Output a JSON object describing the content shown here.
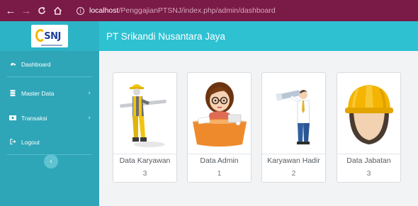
{
  "browser": {
    "url_host": "localhost",
    "url_path": "/PenggajianPTSNJ/index.php/admin/dashboard",
    "icons": [
      "back-arrow-icon",
      "forward-arrow-icon",
      "reload-icon",
      "home-icon",
      "info-icon"
    ]
  },
  "sidebar": {
    "logo_text": "SNJ",
    "items": [
      {
        "label": "Dashboard",
        "icon": "dashboard-icon"
      },
      {
        "label": "Master Data",
        "icon": "database-icon"
      },
      {
        "label": "Transaksi",
        "icon": "money-icon"
      },
      {
        "label": "Logout",
        "icon": "logout-icon"
      }
    ],
    "toggle_icon": "chevron-left-icon"
  },
  "header": {
    "title": "PT Srikandi Nusantara Jaya"
  },
  "cards": [
    {
      "title": "Data Karyawan",
      "count": "3",
      "icon": "worker-illustration"
    },
    {
      "title": "Data Admin",
      "count": "1",
      "icon": "admin-illustration"
    },
    {
      "title": "Karyawan Hadir",
      "count": "2",
      "icon": "telescope-man-illustration"
    },
    {
      "title": "Data Jabatan",
      "count": "3",
      "icon": "hard-hat-illustration"
    }
  ],
  "colors": {
    "browser_bar": "#7a1a46",
    "sidebar": "#2ea6b8",
    "topbar": "#2ec1d2",
    "content_bg": "#f2f3f5"
  }
}
